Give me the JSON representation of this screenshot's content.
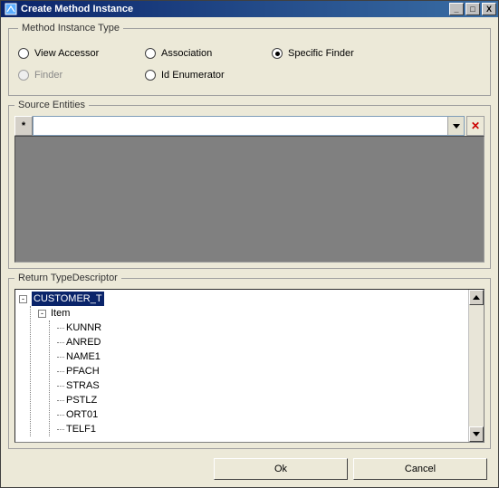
{
  "window": {
    "title": "Create Method Instance"
  },
  "method_instance_type": {
    "legend": "Method Instance Type",
    "options": {
      "view_accessor": "View Accessor",
      "association": "Association",
      "specific_finder": "Specific Finder",
      "finder": "Finder",
      "id_enumerator": "Id Enumerator"
    },
    "selected": "specific_finder",
    "disabled": [
      "finder"
    ]
  },
  "source_entities": {
    "legend": "Source Entities",
    "asterisk": "*",
    "combo_value": "",
    "delete_glyph": "✕"
  },
  "return_type": {
    "legend": "Return TypeDescriptor",
    "tree": {
      "root": "CUSTOMER_T",
      "child": "Item",
      "leaves": [
        "KUNNR",
        "ANRED",
        "NAME1",
        "PFACH",
        "STRAS",
        "PSTLZ",
        "ORT01",
        "TELF1"
      ]
    }
  },
  "buttons": {
    "ok": "Ok",
    "cancel": "Cancel"
  },
  "glyphs": {
    "minus": "-",
    "minimize": "_",
    "maximize": "□",
    "close": "X"
  }
}
